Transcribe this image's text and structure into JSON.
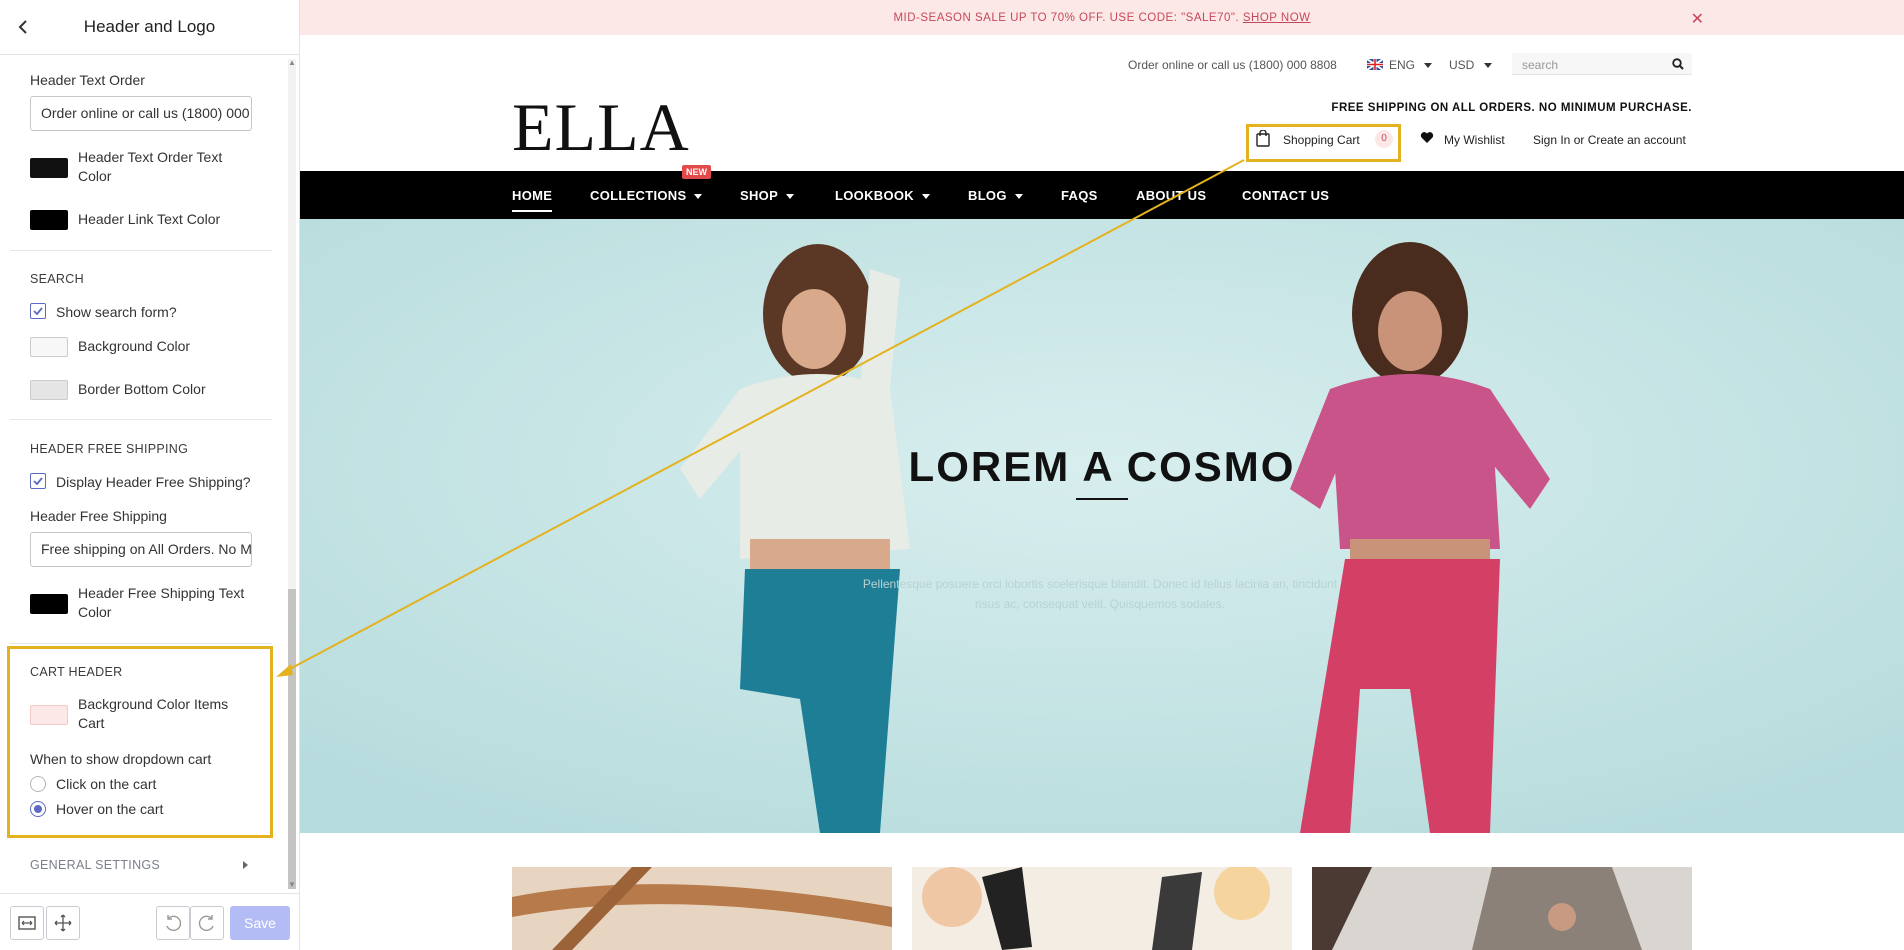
{
  "panel": {
    "title": "Header and Logo",
    "header_text_order_label": "Header Text Order",
    "header_text_order_value": "Order online or call us (1800) 000 8808",
    "header_text_order_color_label": "Header Text Order Text Color",
    "header_link_text_color_label": "Header Link Text Color",
    "search_section": "SEARCH",
    "show_search_form_label": "Show search form?",
    "search_bg_color_label": "Background Color",
    "search_border_color_label": "Border Bottom Color",
    "free_shipping_section": "HEADER FREE SHIPPING",
    "display_free_shipping_label": "Display Header Free Shipping?",
    "header_free_shipping_label": "Header Free Shipping",
    "header_free_shipping_value": "Free shipping on All Orders. No Minimum Purchase.",
    "free_shipping_text_color_label": "Header Free Shipping Text Color",
    "cart_section": "CART HEADER",
    "cart_bg_color_label": "Background Color Items Cart",
    "dropdown_label": "When to show dropdown cart",
    "dropdown_options": [
      "Click on the cart",
      "Hover on the cart"
    ],
    "dropdown_selected": "Hover on the cart",
    "general_settings": "GENERAL SETTINGS",
    "save_label": "Save",
    "colors": {
      "text_order": "#111111",
      "link_text": "#000000",
      "search_bg": "#f7f7f7",
      "search_border": "#e5e5e5",
      "free_shipping_text": "#000000",
      "cart_bg": "#fde8e8",
      "accent": "#5c6ac4",
      "highlight": "#e4b21f"
    }
  },
  "store": {
    "announcement_text": "MID-SEASON SALE UP TO 70% OFF. USE CODE: \"SALE70\".",
    "announcement_link": "SHOP NOW",
    "order_text": "Order online or call us (1800) 000 8808",
    "language": "ENG",
    "currency": "USD",
    "search_placeholder": "search",
    "logo": "ELLA",
    "free_shipping": "FREE SHIPPING ON ALL ORDERS. NO MINIMUM PURCHASE.",
    "cart_label": "Shopping Cart",
    "cart_count": "0",
    "wishlist_label": "My Wishlist",
    "sign_in": "Sign In",
    "or": "or",
    "create_account": "Create an account",
    "nav": [
      "HOME",
      "COLLECTIONS",
      "SHOP",
      "LOOKBOOK",
      "BLOG",
      "FAQS",
      "ABOUT US",
      "CONTACT US"
    ],
    "new_badge": "NEW",
    "hero_title": "LOREM A COSMO",
    "hero_subtitle": "Pellentesque posuere orci lobortis scelerisque blandit. Donec id tellus lacinia an, tincidunt risus ac, consequat velit. Quisquemos sodales."
  }
}
